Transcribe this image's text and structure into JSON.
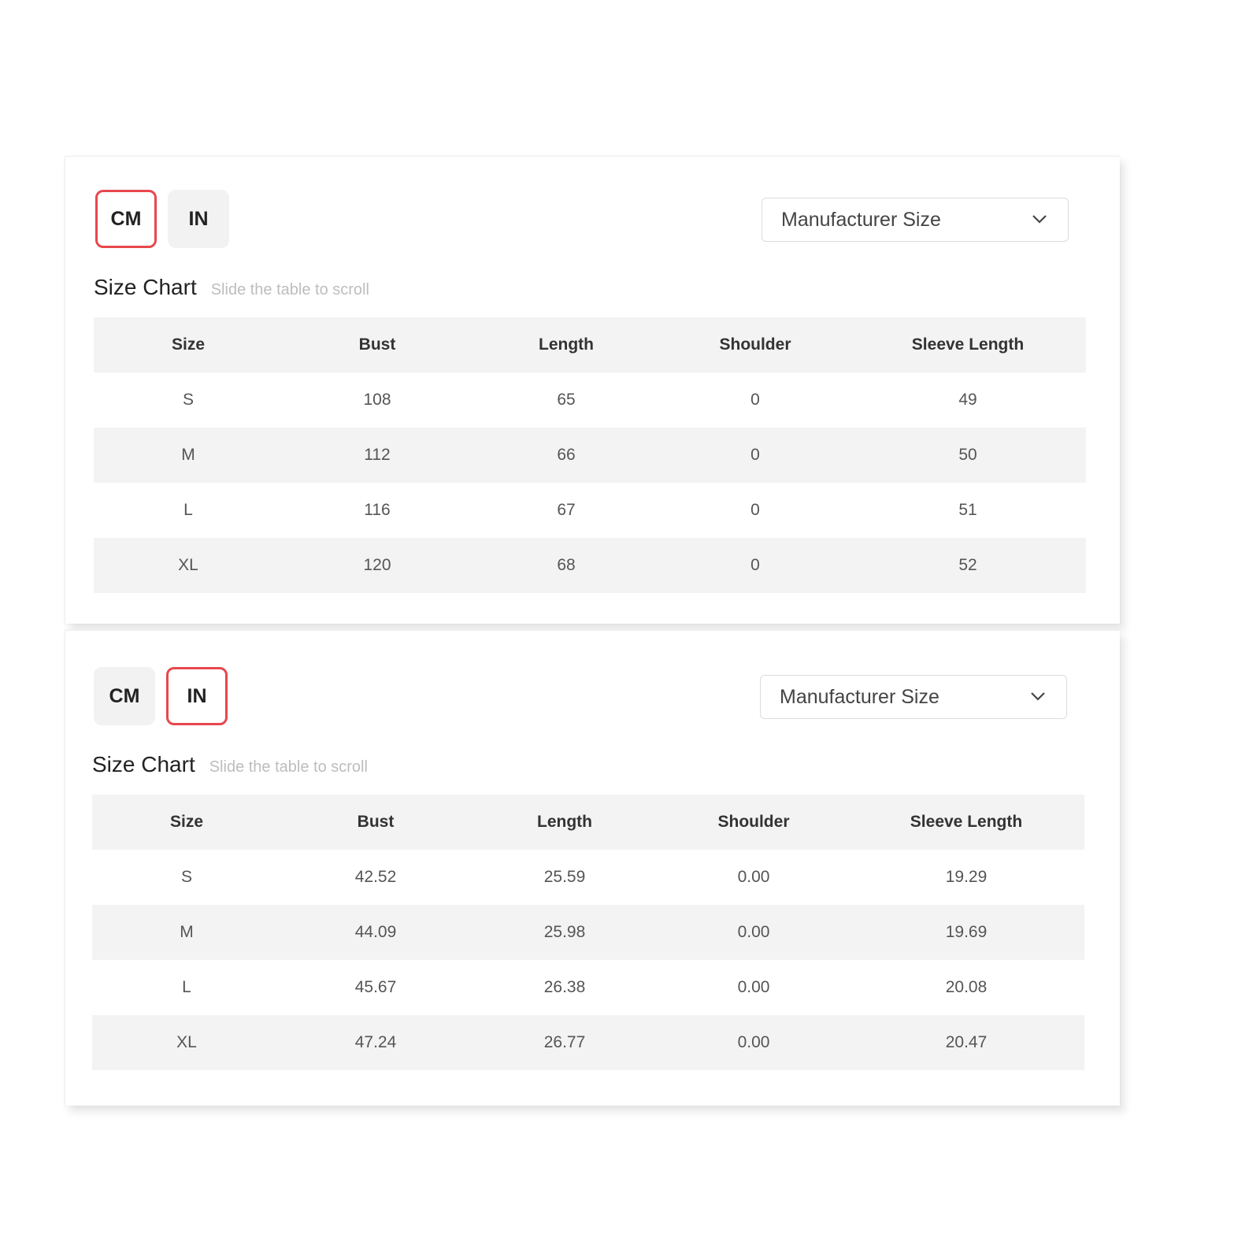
{
  "charts": [
    {
      "units": {
        "cm_label": "CM",
        "in_label": "IN",
        "active": "CM"
      },
      "size_select": {
        "value": "Manufacturer Size"
      },
      "title": "Size Chart",
      "hint": "Slide the table to scroll",
      "columns": [
        "Size",
        "Bust",
        "Length",
        "Shoulder",
        "Sleeve Length"
      ],
      "rows": [
        [
          "S",
          "108",
          "65",
          "0",
          "49"
        ],
        [
          "M",
          "112",
          "66",
          "0",
          "50"
        ],
        [
          "L",
          "116",
          "67",
          "0",
          "51"
        ],
        [
          "XL",
          "120",
          "68",
          "0",
          "52"
        ]
      ]
    },
    {
      "units": {
        "cm_label": "CM",
        "in_label": "IN",
        "active": "IN"
      },
      "size_select": {
        "value": "Manufacturer Size"
      },
      "title": "Size Chart",
      "hint": "Slide the table to scroll",
      "columns": [
        "Size",
        "Bust",
        "Length",
        "Shoulder",
        "Sleeve Length"
      ],
      "rows": [
        [
          "S",
          "42.52",
          "25.59",
          "0.00",
          "19.29"
        ],
        [
          "M",
          "44.09",
          "25.98",
          "0.00",
          "19.69"
        ],
        [
          "L",
          "45.67",
          "26.38",
          "0.00",
          "20.08"
        ],
        [
          "XL",
          "47.24",
          "26.77",
          "0.00",
          "20.47"
        ]
      ]
    }
  ],
  "colors": {
    "accent": "#e8474d",
    "header_bg": "#f3f3f3",
    "hint": "#bdbdbd"
  }
}
